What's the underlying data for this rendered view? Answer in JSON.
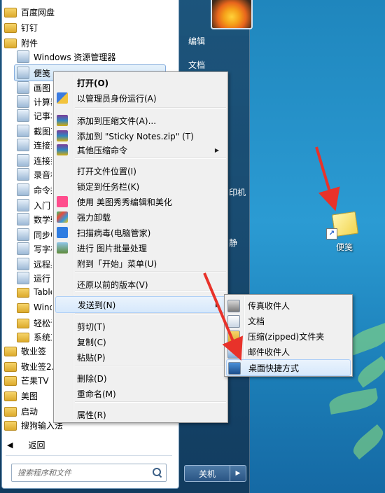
{
  "start_menu": {
    "programs": [
      {
        "label": "百度网盘",
        "icon": "folder-icon"
      },
      {
        "label": "钉钉",
        "icon": "folder-icon"
      },
      {
        "label": "附件",
        "icon": "folder-icon"
      },
      {
        "label": "Windows 资源管理器",
        "icon": "explorer-icon"
      },
      {
        "label": "便笺",
        "icon": "sticky-notes-icon"
      },
      {
        "label": "画图",
        "icon": "paint-icon"
      },
      {
        "label": "计算器",
        "icon": "calculator-icon"
      },
      {
        "label": "记事本",
        "icon": "notepad-icon"
      },
      {
        "label": "截图工具",
        "icon": "snipping-tool-icon"
      },
      {
        "label": "连接到投影仪",
        "icon": "projector-icon"
      },
      {
        "label": "连接到网络投影仪",
        "icon": "network-projector-icon"
      },
      {
        "label": "录音机",
        "icon": "microphone-icon"
      },
      {
        "label": "命令提示符",
        "icon": "cmd-icon"
      },
      {
        "label": "入门",
        "icon": "getting-started-icon"
      },
      {
        "label": "数学输入面板",
        "icon": "math-input-icon"
      },
      {
        "label": "同步中心",
        "icon": "sync-center-icon"
      },
      {
        "label": "写字板",
        "icon": "wordpad-icon"
      },
      {
        "label": "远程桌面连接",
        "icon": "remote-desktop-icon"
      },
      {
        "label": "运行",
        "icon": "run-icon"
      },
      {
        "label": "Tablet PC",
        "icon": "folder-icon"
      },
      {
        "label": "Windows PowerShell",
        "icon": "folder-icon"
      },
      {
        "label": "轻松访问",
        "icon": "folder-icon"
      },
      {
        "label": "系统工具",
        "icon": "folder-icon"
      },
      {
        "label": "敬业签",
        "icon": "folder-icon"
      },
      {
        "label": "敬业签2.0",
        "icon": "folder-icon"
      },
      {
        "label": "芒果TV",
        "icon": "folder-icon"
      },
      {
        "label": "美图",
        "icon": "folder-icon"
      },
      {
        "label": "启动",
        "icon": "folder-icon"
      },
      {
        "label": "搜狗输入法",
        "icon": "folder-icon"
      }
    ],
    "back_label": "返回",
    "search_placeholder": "搜索程序和文件",
    "right_items": [
      "编辑",
      "文档",
      "印机",
      "静"
    ],
    "shutdown_label": "关机"
  },
  "context_menu": {
    "items": [
      {
        "label": "打开(O)",
        "bold": true,
        "icon": ""
      },
      {
        "label": "以管理员身份运行(A)",
        "icon": "uac-shield-icon"
      },
      {
        "label": "添加到压缩文件(A)...",
        "icon": "winrar-icon"
      },
      {
        "label": "添加到 \"Sticky Notes.zip\" (T)",
        "icon": "winrar-icon"
      },
      {
        "label": "其他压缩命令",
        "icon": "winrar-icon",
        "submenu": true
      },
      {
        "label": "打开文件位置(I)",
        "icon": ""
      },
      {
        "label": "锁定到任务栏(K)",
        "icon": ""
      },
      {
        "label": "使用 美图秀秀编辑和美化",
        "icon": "meitu-icon"
      },
      {
        "label": "强力卸载",
        "icon": "uninstall-icon"
      },
      {
        "label": "扫描病毒(电脑管家)",
        "icon": "tencent-shield-icon"
      },
      {
        "label": "进行 图片批量处理",
        "icon": "batch-image-icon"
      },
      {
        "label": "附到「开始」菜单(U)",
        "icon": ""
      },
      {
        "label": "还原以前的版本(V)",
        "icon": ""
      },
      {
        "label": "发送到(N)",
        "icon": "",
        "submenu": true
      },
      {
        "label": "剪切(T)",
        "icon": ""
      },
      {
        "label": "复制(C)",
        "icon": ""
      },
      {
        "label": "粘贴(P)",
        "icon": ""
      },
      {
        "label": "删除(D)",
        "icon": ""
      },
      {
        "label": "重命名(M)",
        "icon": ""
      },
      {
        "label": "属性(R)",
        "icon": ""
      }
    ],
    "submenu_arrow": "▶"
  },
  "sendto_menu": {
    "items": [
      {
        "label": "传真收件人",
        "icon": "fax-icon"
      },
      {
        "label": "文档",
        "icon": "documents-icon"
      },
      {
        "label": "压缩(zipped)文件夹",
        "icon": "zip-folder-icon"
      },
      {
        "label": "邮件收件人",
        "icon": "mail-icon"
      },
      {
        "label": "桌面快捷方式",
        "icon": "desktop-icon"
      }
    ]
  },
  "desktop": {
    "shortcut_label": "便笺"
  },
  "colors": {
    "annotation_arrow": "#e8322a",
    "menu_highlight": "#d6e8fb",
    "desktop_blue": "#2b9bd3"
  }
}
